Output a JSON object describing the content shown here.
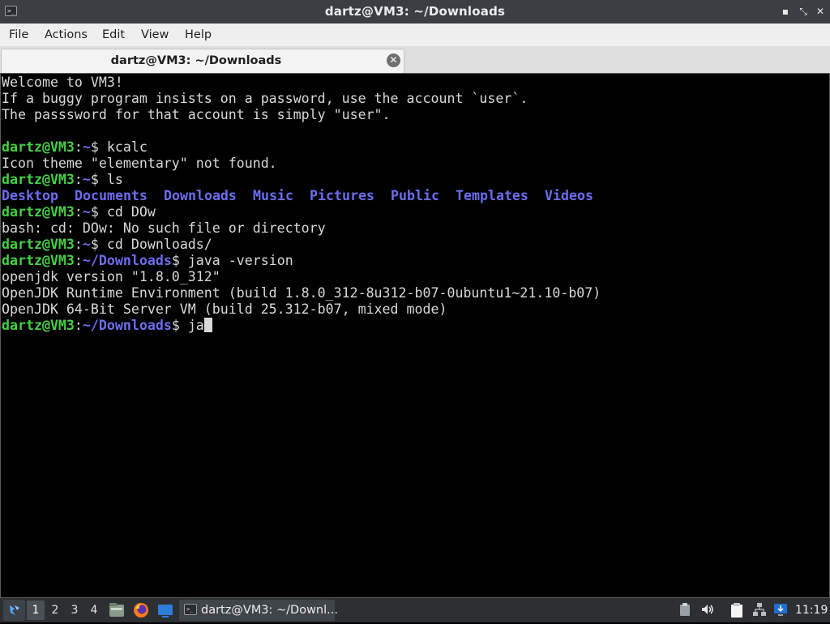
{
  "window": {
    "title": "dartz@VM3: ~/Downloads",
    "minimize_glyph": "▪",
    "maximize_glyph": "⤡",
    "close_glyph": "✕"
  },
  "menu": {
    "items": [
      "File",
      "Actions",
      "Edit",
      "View",
      "Help"
    ]
  },
  "tab": {
    "label": "dartz@VM3: ~/Downloads",
    "close_glyph": "✕"
  },
  "terminal": {
    "lines": [
      {
        "type": "text",
        "text": "Welcome to VM3!"
      },
      {
        "type": "text",
        "text": "If a buggy program insists on a password, use the account `user`."
      },
      {
        "type": "text",
        "text": "The passsword for that account is simply \"user\"."
      },
      {
        "type": "text",
        "text": ""
      },
      {
        "type": "prompt",
        "user": "dartz@VM3",
        "sep": ":",
        "path": "~",
        "sym": "$ ",
        "cmd": "kcalc"
      },
      {
        "type": "text",
        "text": "Icon theme \"elementary\" not found."
      },
      {
        "type": "prompt",
        "user": "dartz@VM3",
        "sep": ":",
        "path": "~",
        "sym": "$ ",
        "cmd": "ls"
      },
      {
        "type": "dirs",
        "items": [
          "Desktop",
          "Documents",
          "Downloads",
          "Music",
          "Pictures",
          "Public",
          "Templates",
          "Videos"
        ]
      },
      {
        "type": "prompt",
        "user": "dartz@VM3",
        "sep": ":",
        "path": "~",
        "sym": "$ ",
        "cmd": "cd DOw"
      },
      {
        "type": "text",
        "text": "bash: cd: DOw: No such file or directory"
      },
      {
        "type": "prompt",
        "user": "dartz@VM3",
        "sep": ":",
        "path": "~",
        "sym": "$ ",
        "cmd": "cd Downloads/"
      },
      {
        "type": "prompt",
        "user": "dartz@VM3",
        "sep": ":",
        "path": "~/Downloads",
        "sym": "$ ",
        "cmd": "java -version"
      },
      {
        "type": "text",
        "text": "openjdk version \"1.8.0_312\""
      },
      {
        "type": "text",
        "text": "OpenJDK Runtime Environment (build 1.8.0_312-8u312-b07-0ubuntu1~21.10-b07)"
      },
      {
        "type": "text",
        "text": "OpenJDK 64-Bit Server VM (build 25.312-b07, mixed mode)"
      },
      {
        "type": "prompt",
        "user": "dartz@VM3",
        "sep": ":",
        "path": "~/Downloads",
        "sym": "$ ",
        "cmd": "ja",
        "cursor": true
      }
    ]
  },
  "taskbar": {
    "workspaces": [
      "1",
      "2",
      "3",
      "4"
    ],
    "active_workspace": "1",
    "launchers": [
      "file-manager-icon",
      "firefox-icon",
      "desktop-icon"
    ],
    "task_label": "dartz@VM3: ~/Downl...",
    "tray": [
      "clipboard-icon",
      "volume-icon",
      "notes-icon",
      "network-icon",
      "update-icon"
    ],
    "clock": "11:19",
    "colors": {
      "panel": "#2c3033",
      "terminal_user": "#44d044",
      "terminal_path": "#6c6cf0"
    }
  }
}
